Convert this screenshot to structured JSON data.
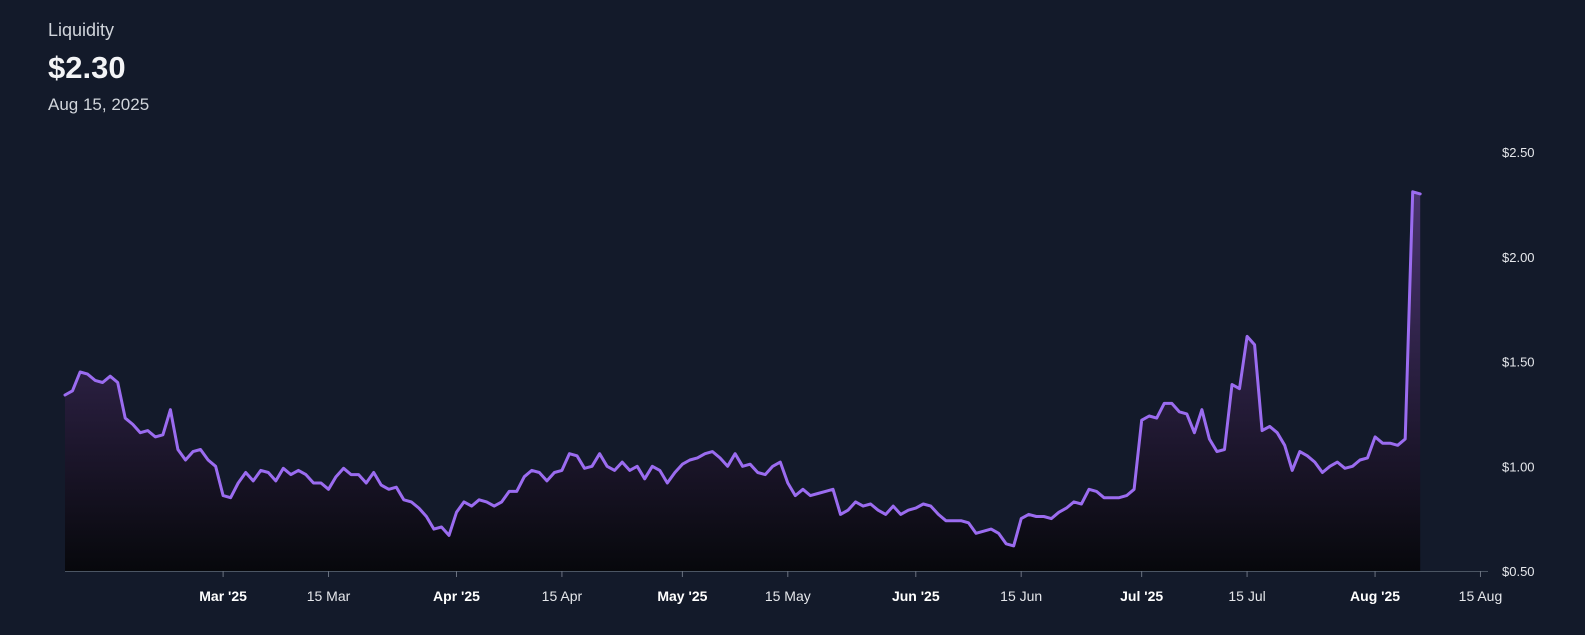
{
  "header": {
    "metric": "Liquidity",
    "value": "$2.30",
    "date": "Aug 15, 2025"
  },
  "chart_data": {
    "type": "area",
    "title": "",
    "xlabel": "",
    "ylabel": "",
    "x_range": [
      "2025-02-08",
      "2025-08-16"
    ],
    "ylim": [
      0.5,
      2.5
    ],
    "y_ticks": [
      {
        "value": 0.5,
        "label": "$0.50"
      },
      {
        "value": 1.0,
        "label": "$1.00"
      },
      {
        "value": 1.5,
        "label": "$1.50"
      },
      {
        "value": 2.0,
        "label": "$2.00"
      },
      {
        "value": 2.5,
        "label": "$2.50"
      }
    ],
    "x_ticks": [
      {
        "date": "2025-03-01",
        "label": "Mar '25",
        "major": true
      },
      {
        "date": "2025-03-15",
        "label": "15 Mar",
        "major": false
      },
      {
        "date": "2025-04-01",
        "label": "Apr '25",
        "major": true
      },
      {
        "date": "2025-04-15",
        "label": "15 Apr",
        "major": false
      },
      {
        "date": "2025-05-01",
        "label": "May '25",
        "major": true
      },
      {
        "date": "2025-05-15",
        "label": "15 May",
        "major": false
      },
      {
        "date": "2025-06-01",
        "label": "Jun '25",
        "major": true
      },
      {
        "date": "2025-06-15",
        "label": "15 Jun",
        "major": false
      },
      {
        "date": "2025-07-01",
        "label": "Jul '25",
        "major": true
      },
      {
        "date": "2025-07-15",
        "label": "15 Jul",
        "major": false
      },
      {
        "date": "2025-08-01",
        "label": "Aug '25",
        "major": true
      },
      {
        "date": "2025-08-15",
        "label": "15 Aug",
        "major": false
      }
    ],
    "line_color": "#9b6cf0",
    "fill_top_color": "#4a3470",
    "fill_bottom_color": "#07080c",
    "series": [
      {
        "points": [
          [
            "2025-02-08",
            1.34
          ],
          [
            "2025-02-09",
            1.36
          ],
          [
            "2025-02-10",
            1.45
          ],
          [
            "2025-02-11",
            1.44
          ],
          [
            "2025-02-12",
            1.41
          ],
          [
            "2025-02-13",
            1.4
          ],
          [
            "2025-02-14",
            1.43
          ],
          [
            "2025-02-15",
            1.4
          ],
          [
            "2025-02-16",
            1.23
          ],
          [
            "2025-02-17",
            1.2
          ],
          [
            "2025-02-18",
            1.16
          ],
          [
            "2025-02-19",
            1.17
          ],
          [
            "2025-02-20",
            1.14
          ],
          [
            "2025-02-21",
            1.15
          ],
          [
            "2025-02-22",
            1.27
          ],
          [
            "2025-02-23",
            1.08
          ],
          [
            "2025-02-24",
            1.03
          ],
          [
            "2025-02-25",
            1.07
          ],
          [
            "2025-02-26",
            1.08
          ],
          [
            "2025-02-27",
            1.03
          ],
          [
            "2025-02-28",
            1.0
          ],
          [
            "2025-03-01",
            0.86
          ],
          [
            "2025-03-02",
            0.85
          ],
          [
            "2025-03-03",
            0.92
          ],
          [
            "2025-03-04",
            0.97
          ],
          [
            "2025-03-05",
            0.93
          ],
          [
            "2025-03-06",
            0.98
          ],
          [
            "2025-03-07",
            0.97
          ],
          [
            "2025-03-08",
            0.93
          ],
          [
            "2025-03-09",
            0.99
          ],
          [
            "2025-03-10",
            0.96
          ],
          [
            "2025-03-11",
            0.98
          ],
          [
            "2025-03-12",
            0.96
          ],
          [
            "2025-03-13",
            0.92
          ],
          [
            "2025-03-14",
            0.92
          ],
          [
            "2025-03-15",
            0.89
          ],
          [
            "2025-03-16",
            0.95
          ],
          [
            "2025-03-17",
            0.99
          ],
          [
            "2025-03-18",
            0.96
          ],
          [
            "2025-03-19",
            0.96
          ],
          [
            "2025-03-20",
            0.92
          ],
          [
            "2025-03-21",
            0.97
          ],
          [
            "2025-03-22",
            0.91
          ],
          [
            "2025-03-23",
            0.89
          ],
          [
            "2025-03-24",
            0.9
          ],
          [
            "2025-03-25",
            0.84
          ],
          [
            "2025-03-26",
            0.83
          ],
          [
            "2025-03-27",
            0.8
          ],
          [
            "2025-03-28",
            0.76
          ],
          [
            "2025-03-29",
            0.7
          ],
          [
            "2025-03-30",
            0.71
          ],
          [
            "2025-03-31",
            0.67
          ],
          [
            "2025-04-01",
            0.78
          ],
          [
            "2025-04-02",
            0.83
          ],
          [
            "2025-04-03",
            0.81
          ],
          [
            "2025-04-04",
            0.84
          ],
          [
            "2025-04-05",
            0.83
          ],
          [
            "2025-04-06",
            0.81
          ],
          [
            "2025-04-07",
            0.83
          ],
          [
            "2025-04-08",
            0.88
          ],
          [
            "2025-04-09",
            0.88
          ],
          [
            "2025-04-10",
            0.95
          ],
          [
            "2025-04-11",
            0.98
          ],
          [
            "2025-04-12",
            0.97
          ],
          [
            "2025-04-13",
            0.93
          ],
          [
            "2025-04-14",
            0.97
          ],
          [
            "2025-04-15",
            0.98
          ],
          [
            "2025-04-16",
            1.06
          ],
          [
            "2025-04-17",
            1.05
          ],
          [
            "2025-04-18",
            0.99
          ],
          [
            "2025-04-19",
            1.0
          ],
          [
            "2025-04-20",
            1.06
          ],
          [
            "2025-04-21",
            1.0
          ],
          [
            "2025-04-22",
            0.98
          ],
          [
            "2025-04-23",
            1.02
          ],
          [
            "2025-04-24",
            0.98
          ],
          [
            "2025-04-25",
            1.0
          ],
          [
            "2025-04-26",
            0.94
          ],
          [
            "2025-04-27",
            1.0
          ],
          [
            "2025-04-28",
            0.98
          ],
          [
            "2025-04-29",
            0.92
          ],
          [
            "2025-04-30",
            0.97
          ],
          [
            "2025-05-01",
            1.01
          ],
          [
            "2025-05-02",
            1.03
          ],
          [
            "2025-05-03",
            1.04
          ],
          [
            "2025-05-04",
            1.06
          ],
          [
            "2025-05-05",
            1.07
          ],
          [
            "2025-05-06",
            1.04
          ],
          [
            "2025-05-07",
            1.0
          ],
          [
            "2025-05-08",
            1.06
          ],
          [
            "2025-05-09",
            1.0
          ],
          [
            "2025-05-10",
            1.01
          ],
          [
            "2025-05-11",
            0.97
          ],
          [
            "2025-05-12",
            0.96
          ],
          [
            "2025-05-13",
            1.0
          ],
          [
            "2025-05-14",
            1.02
          ],
          [
            "2025-05-15",
            0.92
          ],
          [
            "2025-05-16",
            0.86
          ],
          [
            "2025-05-17",
            0.89
          ],
          [
            "2025-05-18",
            0.86
          ],
          [
            "2025-05-19",
            0.87
          ],
          [
            "2025-05-20",
            0.88
          ],
          [
            "2025-05-21",
            0.89
          ],
          [
            "2025-05-22",
            0.77
          ],
          [
            "2025-05-23",
            0.79
          ],
          [
            "2025-05-24",
            0.83
          ],
          [
            "2025-05-25",
            0.81
          ],
          [
            "2025-05-26",
            0.82
          ],
          [
            "2025-05-27",
            0.79
          ],
          [
            "2025-05-28",
            0.77
          ],
          [
            "2025-05-29",
            0.81
          ],
          [
            "2025-05-30",
            0.77
          ],
          [
            "2025-05-31",
            0.79
          ],
          [
            "2025-06-01",
            0.8
          ],
          [
            "2025-06-02",
            0.82
          ],
          [
            "2025-06-03",
            0.81
          ],
          [
            "2025-06-04",
            0.77
          ],
          [
            "2025-06-05",
            0.74
          ],
          [
            "2025-06-06",
            0.74
          ],
          [
            "2025-06-07",
            0.74
          ],
          [
            "2025-06-08",
            0.73
          ],
          [
            "2025-06-09",
            0.68
          ],
          [
            "2025-06-10",
            0.69
          ],
          [
            "2025-06-11",
            0.7
          ],
          [
            "2025-06-12",
            0.68
          ],
          [
            "2025-06-13",
            0.63
          ],
          [
            "2025-06-14",
            0.62
          ],
          [
            "2025-06-15",
            0.75
          ],
          [
            "2025-06-16",
            0.77
          ],
          [
            "2025-06-17",
            0.76
          ],
          [
            "2025-06-18",
            0.76
          ],
          [
            "2025-06-19",
            0.75
          ],
          [
            "2025-06-20",
            0.78
          ],
          [
            "2025-06-21",
            0.8
          ],
          [
            "2025-06-22",
            0.83
          ],
          [
            "2025-06-23",
            0.82
          ],
          [
            "2025-06-24",
            0.89
          ],
          [
            "2025-06-25",
            0.88
          ],
          [
            "2025-06-26",
            0.85
          ],
          [
            "2025-06-27",
            0.85
          ],
          [
            "2025-06-28",
            0.85
          ],
          [
            "2025-06-29",
            0.86
          ],
          [
            "2025-06-30",
            0.89
          ],
          [
            "2025-07-01",
            1.22
          ],
          [
            "2025-07-02",
            1.24
          ],
          [
            "2025-07-03",
            1.23
          ],
          [
            "2025-07-04",
            1.3
          ],
          [
            "2025-07-05",
            1.3
          ],
          [
            "2025-07-06",
            1.26
          ],
          [
            "2025-07-07",
            1.25
          ],
          [
            "2025-07-08",
            1.16
          ],
          [
            "2025-07-09",
            1.27
          ],
          [
            "2025-07-10",
            1.13
          ],
          [
            "2025-07-11",
            1.07
          ],
          [
            "2025-07-12",
            1.08
          ],
          [
            "2025-07-13",
            1.39
          ],
          [
            "2025-07-14",
            1.37
          ],
          [
            "2025-07-15",
            1.62
          ],
          [
            "2025-07-16",
            1.58
          ],
          [
            "2025-07-17",
            1.17
          ],
          [
            "2025-07-18",
            1.19
          ],
          [
            "2025-07-19",
            1.16
          ],
          [
            "2025-07-20",
            1.1
          ],
          [
            "2025-07-21",
            0.98
          ],
          [
            "2025-07-22",
            1.07
          ],
          [
            "2025-07-23",
            1.05
          ],
          [
            "2025-07-24",
            1.02
          ],
          [
            "2025-07-25",
            0.97
          ],
          [
            "2025-07-26",
            1.0
          ],
          [
            "2025-07-27",
            1.02
          ],
          [
            "2025-07-28",
            0.99
          ],
          [
            "2025-07-29",
            1.0
          ],
          [
            "2025-07-30",
            1.03
          ],
          [
            "2025-07-31",
            1.04
          ],
          [
            "2025-08-01",
            1.14
          ],
          [
            "2025-08-02",
            1.11
          ],
          [
            "2025-08-03",
            1.11
          ],
          [
            "2025-08-04",
            1.1
          ],
          [
            "2025-08-05",
            1.13
          ],
          [
            "2025-08-06",
            2.31
          ],
          [
            "2025-08-07",
            2.3
          ]
        ]
      }
    ]
  }
}
